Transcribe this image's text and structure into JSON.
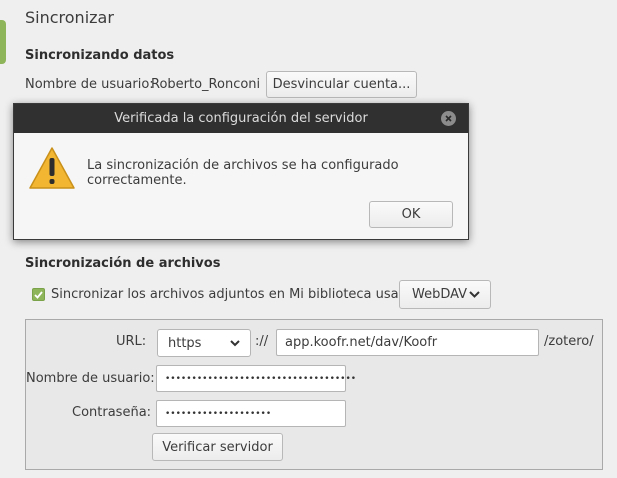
{
  "pane": {
    "title": "Sincronizar"
  },
  "data_sync": {
    "heading": "Sincronizando datos",
    "username_label": "Nombre de usuario:",
    "username_value": "Roberto_Ronconi",
    "unlink_button": "Desvincular cuenta..."
  },
  "file_sync": {
    "heading": "Sincronización de archivos",
    "checkbox_label": "Sincronizar los archivos adjuntos en Mi biblioteca usando",
    "checkbox_checked": true,
    "method": "WebDAV",
    "url_label": "URL:",
    "scheme": "https",
    "scheme_separator": "://",
    "url_value": "app.koofr.net/dav/Koofr",
    "url_suffix": "/zotero/",
    "username_label": "Nombre de usuario:",
    "username_masked": "••••••••••••••••••••••••••••••••••••",
    "password_label": "Contraseña:",
    "password_masked": "••••••••••••••••••••",
    "verify_button": "Verificar servidor"
  },
  "dialog": {
    "title": "Verificada la configuración del servidor",
    "message": "La sincronización de archivos se ha configurado correctamente.",
    "ok_button": "OK",
    "icon": "warning-icon",
    "close_icon": "close-icon"
  },
  "colors": {
    "accent": "#8fb55a",
    "titlebar": "#303030",
    "warning": "#f2b632"
  }
}
